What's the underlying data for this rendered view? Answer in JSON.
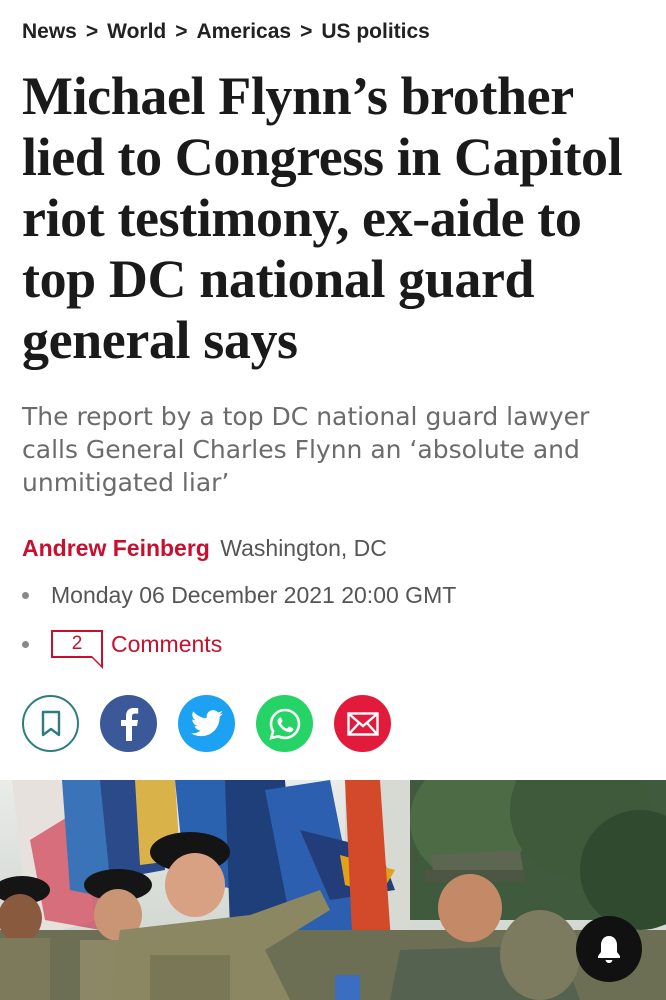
{
  "breadcrumb": {
    "items": [
      "News",
      "World",
      "Americas",
      "US politics"
    ],
    "separator": ">"
  },
  "article": {
    "headline": "Michael Flynn’s brother lied to Congress in Capitol riot testimony, ex-aide to top DC national guard general says",
    "standfirst": "The report by a top DC national guard lawyer calls General Charles Flynn an ‘absolute and unmitigated liar’",
    "author": "Andrew Feinberg",
    "location": "Washington, DC",
    "date": "Monday 06 December 2021 20:00 GMT",
    "comments_count": "2",
    "comments_label": "Comments"
  },
  "share": {
    "icons": [
      "bookmark-icon",
      "facebook-icon",
      "twitter-icon",
      "whatsapp-icon",
      "email-icon"
    ]
  },
  "colors": {
    "accent": "#c8102e",
    "facebook": "#3b5998",
    "twitter": "#1da1f2",
    "whatsapp": "#25d366",
    "email": "#e21b3c",
    "bookmark": "#2d7d80"
  }
}
